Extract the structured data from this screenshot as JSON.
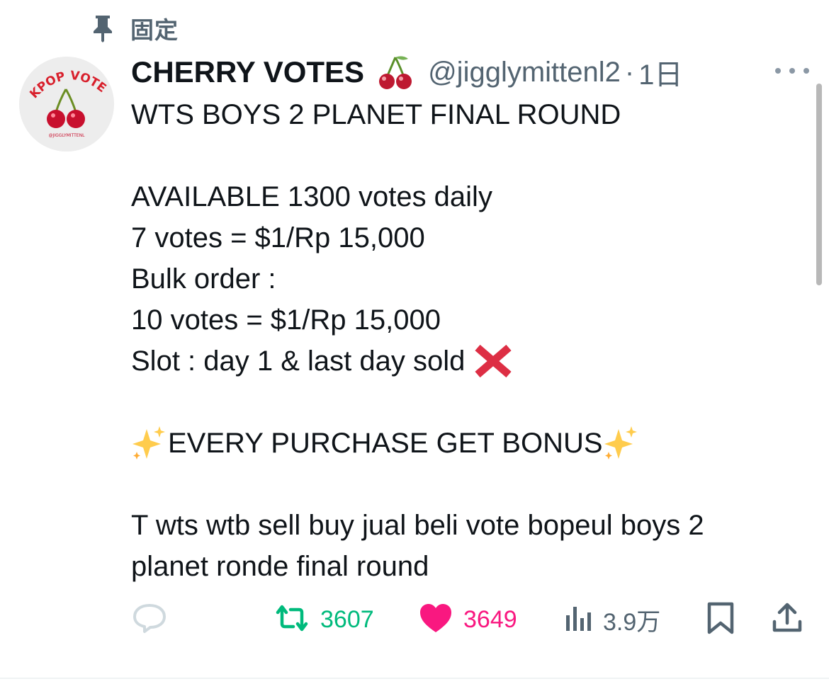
{
  "pinned": {
    "label": "固定",
    "icon": "pin-icon"
  },
  "author": {
    "avatar_text": "KPOP VOTES",
    "avatar_small_text": "@JIGGLYMITTENL",
    "display_name": "CHERRY VOTES",
    "name_emoji": "cherries-emoji",
    "handle": "@jigglymittenl2",
    "separator": "·",
    "time": "1日"
  },
  "tweet": {
    "lines": [
      "WTS BOYS 2 PLANET FINAL ROUND",
      "",
      "AVAILABLE 1300 votes daily",
      "7 votes = $1/Rp 15,000",
      "Bulk order :",
      "10 votes = $1/Rp 15,000",
      "Slot : day 1 & last day sold",
      "",
      "EVERY PURCHASE GET BONUS",
      "",
      "T wts wtb sell buy jual beli vote bopeul boys 2",
      "planet ronde final round"
    ],
    "slot_emoji": "cross-mark-emoji",
    "bonus_emoji": "sparkles-emoji"
  },
  "actions": {
    "reply_icon": "reply-icon",
    "retweet_icon": "retweet-icon",
    "retweet_count": "3607",
    "like_icon": "heart-icon",
    "like_count": "3649",
    "views_icon": "views-icon",
    "views_count": "3.9万",
    "bookmark_icon": "bookmark-icon",
    "share_icon": "share-icon"
  },
  "colors": {
    "text": "#0f1419",
    "secondary": "#536471",
    "retweet": "#00ba7c",
    "like": "#f91880",
    "reply": "#cfd9de"
  }
}
